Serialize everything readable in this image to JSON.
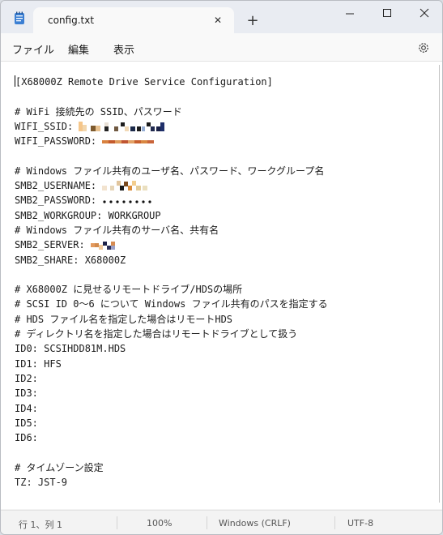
{
  "tab": {
    "title": "config.txt",
    "close_glyph": "✕",
    "new_tab_glyph": "+"
  },
  "menu": {
    "file": "ファイル",
    "edit": "編集",
    "view": "表示"
  },
  "icons": {
    "app": "notepad-icon",
    "settings": "gear-icon",
    "minimize": "minimize-icon",
    "maximize": "maximize-icon",
    "close": "close-icon"
  },
  "editor": {
    "lines": [
      "[X68000Z Remote Drive Service Configuration]",
      "",
      "# WiFi 接続先の SSID、パスワード",
      "WIFI_SSID: ",
      "WIFI_PASSWORD: ",
      "",
      "# Windows ファイル共有のユーザ名、パスワード、ワークグループ名",
      "SMB2_USERNAME: ",
      "SMB2_PASSWORD: ",
      "SMB2_WORKGROUP: WORKGROUP",
      "# Windows ファイル共有のサーバ名、共有名",
      "SMB2_SERVER: ",
      "SMB2_SHARE: X68000Z",
      "",
      "# X68000Z に見せるリモートドライブ/HDSの場所",
      "# SCSI ID 0～6 について Windows ファイル共有のパスを指定する",
      "# HDS ファイル名を指定した場合はリモートHDS",
      "# ディレクトリ名を指定した場合はリモートドライブとして扱う",
      "ID0: SCSIHDD81M.HDS",
      "ID1: HFS",
      "ID2:",
      "ID3:",
      "ID4:",
      "ID5:",
      "ID6:",
      "",
      "# タイムゾーン設定",
      "TZ: JST-9"
    ]
  },
  "status": {
    "position": "行 1、列 1",
    "zoom": "100%",
    "line_ending": "Windows (CRLF)",
    "encoding": "UTF-8"
  },
  "colors": {
    "titlebar": "#e9ecf2",
    "tab_active": "#f9f9f9",
    "editor_bg": "#ffffff",
    "status_bg": "#f3f3f3"
  }
}
